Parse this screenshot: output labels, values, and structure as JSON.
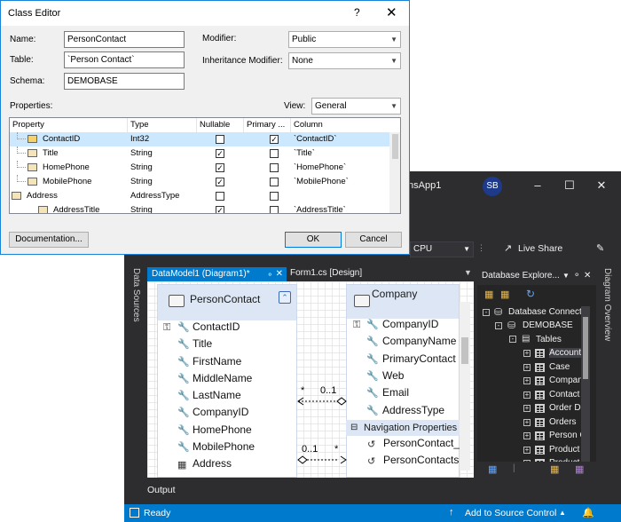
{
  "vs": {
    "app_name": "nsApp1",
    "avatar": "SB",
    "cpu": "CPU",
    "live_share": "Live Share",
    "side_tab_left": "Data Sources",
    "side_tab_right": "Diagram Overview",
    "tabs": [
      {
        "label": "DataModel1 (Diagram1)*",
        "active": true
      },
      {
        "label": "Form1.cs [Design]",
        "active": false
      }
    ],
    "output_label": "Output",
    "status": {
      "ready": "Ready",
      "source_control": "Add to Source Control"
    },
    "accent": "#007acc"
  },
  "diagram": {
    "person": {
      "name": "PersonContact",
      "properties": [
        "ContactID",
        "Title",
        "FirstName",
        "MiddleName",
        "LastName",
        "CompanyID",
        "HomePhone",
        "MobilePhone",
        "Address"
      ]
    },
    "company": {
      "name": "Company",
      "properties": [
        "CompanyID",
        "CompanyName",
        "PrimaryContact",
        "Web",
        "Email",
        "AddressType"
      ],
      "nav_header": "Navigation Properties",
      "nav_properties": [
        "PersonContact_",
        "PersonContacts"
      ]
    },
    "assoc1": {
      "left": "*",
      "right": "0..1"
    },
    "assoc2": {
      "left": "0..1",
      "right": "*"
    }
  },
  "db_explorer": {
    "title": "Database Explore...",
    "connections": "Database Connecti",
    "db": "DEMOBASE",
    "tables_label": "Tables",
    "tables": [
      "Account",
      "Case",
      "Compan",
      "Contact",
      "Order De",
      "Orders",
      "Person C",
      "Product C",
      "Product"
    ]
  },
  "dialog": {
    "title": "Class Editor",
    "name_label": "Name:",
    "name_value": "PersonContact",
    "table_label": "Table:",
    "table_value": "`Person Contact`",
    "schema_label": "Schema:",
    "schema_value": "DEMOBASE",
    "modifier_label": "Modifier:",
    "modifier_value": "Public",
    "inheritance_label": "Inheritance Modifier:",
    "inheritance_value": "None",
    "properties_label": "Properties:",
    "view_label": "View:",
    "view_value": "General",
    "columns": [
      "Property",
      "Type",
      "Nullable",
      "Primary ...",
      "Column"
    ],
    "rows": [
      {
        "property": "ContactID",
        "type": "Int32",
        "nullable": false,
        "primary": true,
        "column": "`ContactID`"
      },
      {
        "property": "Title",
        "type": "String",
        "nullable": true,
        "primary": false,
        "column": "`Title`"
      },
      {
        "property": "HomePhone",
        "type": "String",
        "nullable": true,
        "primary": false,
        "column": "`HomePhone`"
      },
      {
        "property": "MobilePhone",
        "type": "String",
        "nullable": true,
        "primary": false,
        "column": "`MobilePhone`"
      },
      {
        "property": "Address",
        "type": "AddressType",
        "nullable": false,
        "primary": false,
        "column": ""
      },
      {
        "property": "AddressTitle",
        "type": "String",
        "nullable": true,
        "primary": false,
        "column": "`AddressTitle`"
      }
    ],
    "documentation_button": "Documentation...",
    "ok_button": "OK",
    "cancel_button": "Cancel"
  }
}
